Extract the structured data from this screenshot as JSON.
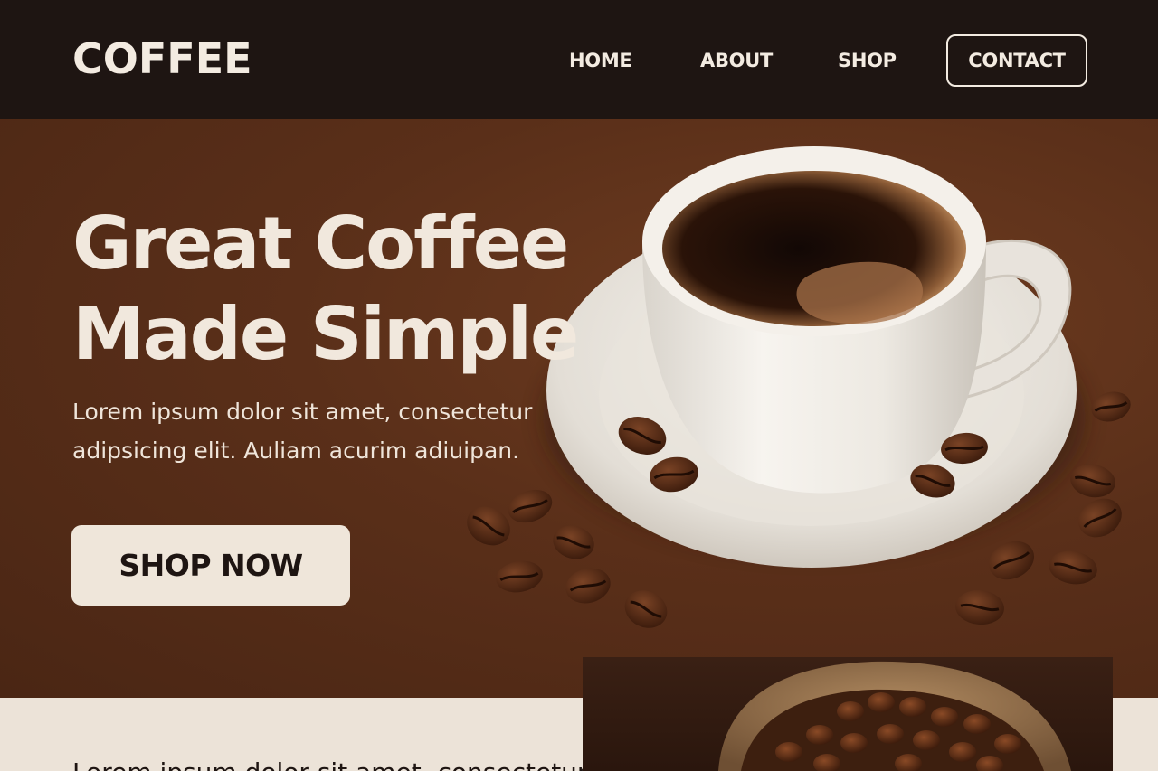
{
  "header": {
    "logo": "COFFEE",
    "nav": {
      "home": "HOME",
      "about": "ABOUT",
      "shop": "SHOP",
      "contact": "CONTACT"
    }
  },
  "hero": {
    "title_line1": "Great Coffee",
    "title_line2": "Made Simple",
    "description": "Lorem ipsum dolor sit amet, consectetur adipsicing elit. Auliam acurim adiuipan.",
    "cta": "SHOP NOW",
    "image": "coffee-cup-with-beans-icon"
  },
  "section2": {
    "text": "Lorem ipsum dolor sit amet, consectetur",
    "image": "coffee-bean-sack-icon"
  },
  "colors": {
    "header_bg": "#1e1512",
    "hero_bg": "#5a2f19",
    "cream": "#efe6da",
    "dark_text": "#1e1512"
  }
}
